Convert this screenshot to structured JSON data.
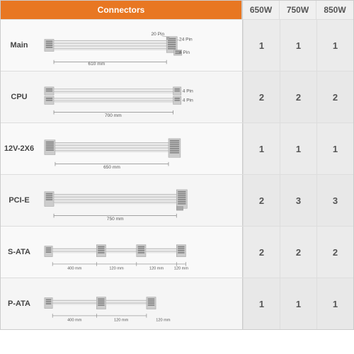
{
  "header": {
    "connector_label": "Connectors",
    "watts": [
      "650W",
      "750W",
      "850W"
    ]
  },
  "rows": [
    {
      "id": "main",
      "label": "Main",
      "diagram": "main",
      "notes": [
        "20 Pin",
        "24 Pin",
        "4 Pin"
      ],
      "cable_length": "610 mm",
      "vals": [
        "1",
        "1",
        "1"
      ]
    },
    {
      "id": "cpu",
      "label": "CPU",
      "diagram": "cpu",
      "notes": [
        "4 Pin",
        "4 Pin"
      ],
      "cable_length": "700 mm",
      "vals": [
        "2",
        "2",
        "2"
      ]
    },
    {
      "id": "12v2x6",
      "label": "12V-2X6",
      "diagram": "12v2x6",
      "notes": [],
      "cable_length": "650 mm",
      "vals": [
        "1",
        "1",
        "1"
      ]
    },
    {
      "id": "pcie",
      "label": "PCI-E",
      "diagram": "pcie",
      "notes": [],
      "cable_length": "750 mm",
      "vals": [
        "2",
        "3",
        "3"
      ]
    },
    {
      "id": "sata",
      "label": "S-ATA",
      "diagram": "sata",
      "notes": [],
      "cable_lengths": [
        "400 mm",
        "120 mm",
        "120 mm",
        "120 mm"
      ],
      "vals": [
        "2",
        "2",
        "2"
      ]
    },
    {
      "id": "pata",
      "label": "P-ATA",
      "diagram": "pata",
      "notes": [],
      "cable_lengths": [
        "400 mm",
        "120 mm",
        "120 mm"
      ],
      "vals": [
        "1",
        "1",
        "1"
      ]
    }
  ]
}
